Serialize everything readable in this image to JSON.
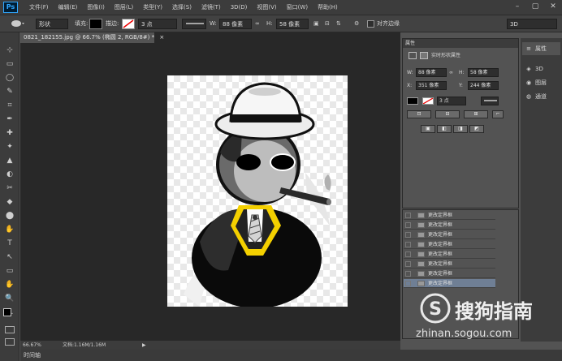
{
  "app": {
    "logo": "Ps"
  },
  "menu": [
    "文件(F)",
    "编辑(E)",
    "图像(I)",
    "图层(L)",
    "类型(Y)",
    "选择(S)",
    "滤镜(T)",
    "3D(D)",
    "视图(V)",
    "窗口(W)",
    "帮助(H)"
  ],
  "window_controls": [
    "–",
    "▢",
    "✕"
  ],
  "options": {
    "shape_mode": "形状",
    "fill_label": "填充:",
    "stroke_label": "描边:",
    "stroke_width": "3 点",
    "w_label": "W:",
    "w_value": "88 像素",
    "link_symbol": "∞",
    "h_label": "H:",
    "h_value": "58 像素",
    "align_edges": "对齐边缘",
    "workspace": "3D"
  },
  "document": {
    "tab_title": "0821_182155.jpg @ 66.7% (椭圆 2, RGB/8#) *",
    "close": "×"
  },
  "status": {
    "zoom": "66.67%",
    "doc_info": "文档:1.16M/1.16M",
    "arrow": "▶"
  },
  "timeline": {
    "label": "时间轴"
  },
  "properties": {
    "title": "属性",
    "subtitle": "实时形状属性",
    "w_label": "W:",
    "w_value": "88 像素",
    "h_label": "H:",
    "h_value": "58 像素",
    "x_label": "X:",
    "x_value": "351 像素",
    "y_label": "Y:",
    "y_value": "244 像素",
    "stroke_width": "3 点"
  },
  "layers": {
    "rows": [
      "更改定界框",
      "更改定界框",
      "更改定界框",
      "更改定界框",
      "更改定界框",
      "更改定界框",
      "更改定界框",
      "更改定界框"
    ],
    "selected_index": 7
  },
  "dock": [
    {
      "icon": "≡",
      "label": "属性"
    },
    {
      "icon": "◈",
      "label": "3D"
    },
    {
      "icon": "◉",
      "label": "图层"
    },
    {
      "icon": "◍",
      "label": "通道"
    }
  ],
  "tools": [
    "⊹",
    "▭",
    "◯",
    "✎",
    "⌗",
    "✒",
    "✚",
    "✦",
    "▲",
    "◐",
    "✂",
    "◆",
    "⬤",
    "✋",
    "T",
    "↖",
    "▭",
    "✋",
    "🔍",
    "…"
  ],
  "watermark": {
    "brand": "搜狗指南",
    "url": "zhinan.sogou.com"
  }
}
